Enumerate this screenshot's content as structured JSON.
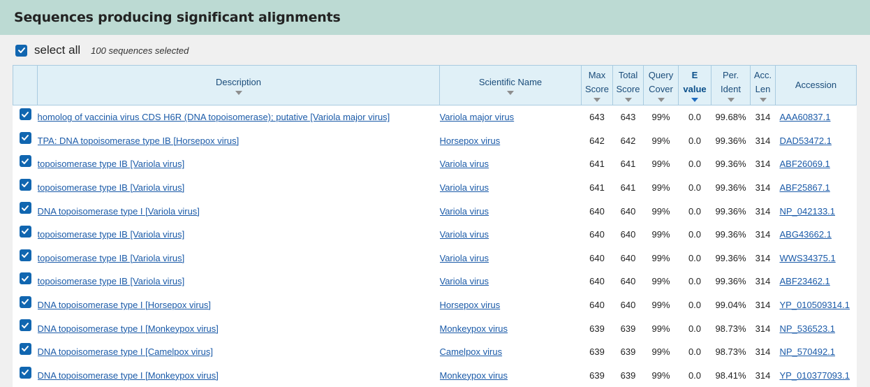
{
  "header": {
    "title": "Sequences producing significant alignments"
  },
  "selection": {
    "label": "select all",
    "count_text": "100 sequences selected"
  },
  "columns": {
    "description": "Description",
    "scientific_name": "Scientific Name",
    "max_score": [
      "Max",
      "Score"
    ],
    "total_score": [
      "Total",
      "Score"
    ],
    "query_cover": [
      "Query",
      "Cover"
    ],
    "e_value": [
      "E",
      "value"
    ],
    "per_ident": [
      "Per.",
      "Ident"
    ],
    "acc_len": [
      "Acc.",
      "Len"
    ],
    "accession": "Accession"
  },
  "rows": [
    {
      "desc": "homolog of vaccinia virus CDS H6R (DNA topoisomerase); putative [Variola major virus]",
      "sci": "Variola major virus",
      "max": "643",
      "total": "643",
      "cover": "99%",
      "e": "0.0",
      "ident": "99.68%",
      "len": "314",
      "acc": "AAA60837.1"
    },
    {
      "desc": "TPA: DNA topoisomerase type IB [Horsepox virus]",
      "sci": "Horsepox virus",
      "max": "642",
      "total": "642",
      "cover": "99%",
      "e": "0.0",
      "ident": "99.36%",
      "len": "314",
      "acc": "DAD53472.1"
    },
    {
      "desc": "topoisomerase type IB [Variola virus]",
      "sci": "Variola virus",
      "max": "641",
      "total": "641",
      "cover": "99%",
      "e": "0.0",
      "ident": "99.36%",
      "len": "314",
      "acc": "ABF26069.1"
    },
    {
      "desc": "topoisomerase type IB [Variola virus]",
      "sci": "Variola virus",
      "max": "641",
      "total": "641",
      "cover": "99%",
      "e": "0.0",
      "ident": "99.36%",
      "len": "314",
      "acc": "ABF25867.1"
    },
    {
      "desc": "DNA topoisomerase type I [Variola virus]",
      "sci": "Variola virus",
      "max": "640",
      "total": "640",
      "cover": "99%",
      "e": "0.0",
      "ident": "99.36%",
      "len": "314",
      "acc": "NP_042133.1"
    },
    {
      "desc": "topoisomerase type IB [Variola virus]",
      "sci": "Variola virus",
      "max": "640",
      "total": "640",
      "cover": "99%",
      "e": "0.0",
      "ident": "99.36%",
      "len": "314",
      "acc": "ABG43662.1"
    },
    {
      "desc": "topoisomerase type IB [Variola virus]",
      "sci": "Variola virus",
      "max": "640",
      "total": "640",
      "cover": "99%",
      "e": "0.0",
      "ident": "99.36%",
      "len": "314",
      "acc": "WWS34375.1"
    },
    {
      "desc": "topoisomerase type IB [Variola virus]",
      "sci": "Variola virus",
      "max": "640",
      "total": "640",
      "cover": "99%",
      "e": "0.0",
      "ident": "99.36%",
      "len": "314",
      "acc": "ABF23462.1"
    },
    {
      "desc": "DNA topoisomerase type I [Horsepox virus]",
      "sci": "Horsepox virus",
      "max": "640",
      "total": "640",
      "cover": "99%",
      "e": "0.0",
      "ident": "99.04%",
      "len": "314",
      "acc": "YP_010509314.1"
    },
    {
      "desc": "DNA topoisomerase type I [Monkeypox virus]",
      "sci": "Monkeypox virus",
      "max": "639",
      "total": "639",
      "cover": "99%",
      "e": "0.0",
      "ident": "98.73%",
      "len": "314",
      "acc": "NP_536523.1"
    },
    {
      "desc": "DNA topoisomerase type I [Camelpox virus]",
      "sci": "Camelpox virus",
      "max": "639",
      "total": "639",
      "cover": "99%",
      "e": "0.0",
      "ident": "98.73%",
      "len": "314",
      "acc": "NP_570492.1"
    },
    {
      "desc": "DNA topoisomerase type I [Monkeypox virus]",
      "sci": "Monkeypox virus",
      "max": "639",
      "total": "639",
      "cover": "99%",
      "e": "0.0",
      "ident": "98.41%",
      "len": "314",
      "acc": "YP_010377093.1"
    }
  ]
}
